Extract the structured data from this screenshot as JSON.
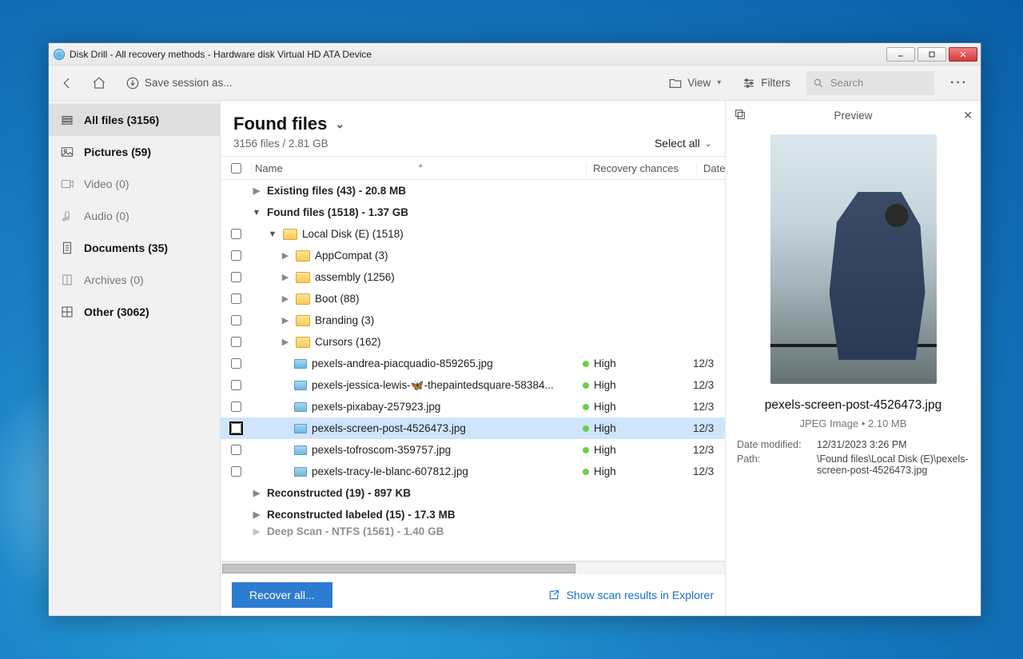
{
  "window": {
    "title": "Disk Drill - All recovery methods - Hardware disk Virtual HD ATA Device"
  },
  "toolbar": {
    "save_session": "Save session as...",
    "view": "View",
    "filters": "Filters",
    "search_placeholder": "Search"
  },
  "sidebar": {
    "items": [
      {
        "id": "all",
        "label": "All files (3156)",
        "icon": "stack",
        "bold": true,
        "active": true
      },
      {
        "id": "pictures",
        "label": "Pictures (59)",
        "icon": "image",
        "bold": true
      },
      {
        "id": "video",
        "label": "Video (0)",
        "icon": "video",
        "muted": true
      },
      {
        "id": "audio",
        "label": "Audio (0)",
        "icon": "audio",
        "muted": true
      },
      {
        "id": "documents",
        "label": "Documents (35)",
        "icon": "doc",
        "bold": true
      },
      {
        "id": "archives",
        "label": "Archives (0)",
        "icon": "archive",
        "muted": true
      },
      {
        "id": "other",
        "label": "Other (3062)",
        "icon": "other",
        "bold": true
      }
    ]
  },
  "header": {
    "title": "Found files",
    "summary": "3156 files / 2.81 GB",
    "select_all": "Select all"
  },
  "columns": {
    "name": "Name",
    "recovery": "Recovery chances",
    "date": "Date"
  },
  "rows": [
    {
      "type": "group",
      "level": 0,
      "label": "Existing files (43) - 20.8 MB",
      "open": false
    },
    {
      "type": "group",
      "level": 0,
      "label": "Found files (1518) - 1.37 GB",
      "open": true
    },
    {
      "type": "folder",
      "level": 1,
      "label": "Local Disk (E) (1518)",
      "open": true,
      "chk": true
    },
    {
      "type": "folder",
      "level": 2,
      "label": "AppCompat (3)",
      "open": false,
      "chk": true
    },
    {
      "type": "folder",
      "level": 2,
      "label": "assembly (1256)",
      "open": false,
      "chk": true
    },
    {
      "type": "folder",
      "level": 2,
      "label": "Boot (88)",
      "open": false,
      "chk": true
    },
    {
      "type": "folder",
      "level": 2,
      "label": "Branding (3)",
      "open": false,
      "chk": true
    },
    {
      "type": "folder",
      "level": 2,
      "label": "Cursors (162)",
      "open": false,
      "chk": true
    },
    {
      "type": "file",
      "level": 3,
      "label": "pexels-andrea-piacquadio-859265.jpg",
      "rec": "High",
      "date": "12/3",
      "chk": true
    },
    {
      "type": "file",
      "level": 3,
      "label": "pexels-jessica-lewis-🦋-thepaintedsquare-58384...",
      "rec": "High",
      "date": "12/3",
      "chk": true
    },
    {
      "type": "file",
      "level": 3,
      "label": "pexels-pixabay-257923.jpg",
      "rec": "High",
      "date": "12/3",
      "chk": true
    },
    {
      "type": "file",
      "level": 3,
      "label": "pexels-screen-post-4526473.jpg",
      "rec": "High",
      "date": "12/3",
      "chk": true,
      "selected": true
    },
    {
      "type": "file",
      "level": 3,
      "label": "pexels-tofroscom-359757.jpg",
      "rec": "High",
      "date": "12/3",
      "chk": true
    },
    {
      "type": "file",
      "level": 3,
      "label": "pexels-tracy-le-blanc-607812.jpg",
      "rec": "High",
      "date": "12/3",
      "chk": true
    },
    {
      "type": "group",
      "level": 0,
      "label": "Reconstructed (19) - 897 KB",
      "open": false
    },
    {
      "type": "group",
      "level": 0,
      "label": "Reconstructed labeled (15) - 17.3 MB",
      "open": false
    },
    {
      "type": "group",
      "level": 0,
      "label": "Deep Scan - NTFS (1561) - 1.40 GB",
      "open": false,
      "cut": true
    }
  ],
  "footer": {
    "recover": "Recover all...",
    "explorer": "Show scan results in Explorer"
  },
  "preview": {
    "label": "Preview",
    "filename": "pexels-screen-post-4526473.jpg",
    "meta": "JPEG Image • 2.10 MB",
    "date_modified_k": "Date modified:",
    "date_modified_v": "12/31/2023 3:26 PM",
    "path_k": "Path:",
    "path_v": "\\Found files\\Local Disk (E)\\pexels-screen-post-4526473.jpg"
  }
}
